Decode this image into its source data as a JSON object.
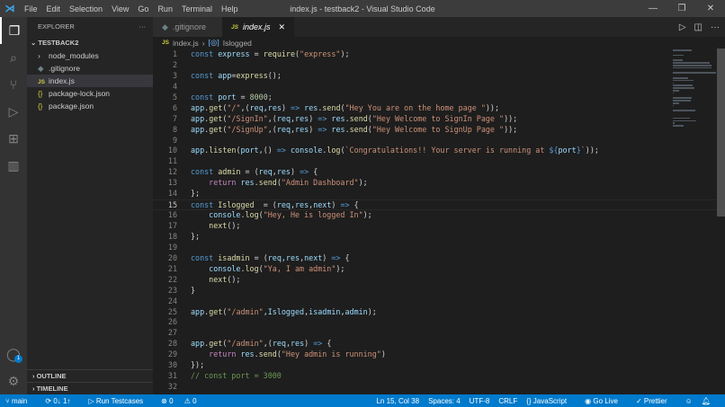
{
  "title_bar": {
    "menus": [
      "File",
      "Edit",
      "Selection",
      "View",
      "Go",
      "Run",
      "Terminal",
      "Help"
    ],
    "window_title": "index.js - testback2 - Visual Studio Code"
  },
  "sidebar": {
    "header": "EXPLORER",
    "more": "···",
    "folder": "TESTBACK2",
    "items": [
      {
        "icon": "chevron-right",
        "label": "node_modules"
      },
      {
        "icon": "gitignore",
        "label": ".gitignore"
      },
      {
        "icon": "js",
        "label": "index.js",
        "selected": true
      },
      {
        "icon": "json",
        "label": "package-lock.json"
      },
      {
        "icon": "json",
        "label": "package.json"
      }
    ],
    "outline": "OUTLINE",
    "timeline": "TIMELINE"
  },
  "tabs": [
    {
      "label": ".gitignore",
      "active": false
    },
    {
      "label": "index.js",
      "active": true
    }
  ],
  "breadcrumb": {
    "file": "index.js",
    "symbol": "Islogged"
  },
  "editor": {
    "current_line": 15,
    "lines": [
      [
        [
          "k",
          "const "
        ],
        [
          "v",
          "express"
        ],
        [
          "p",
          " = "
        ],
        [
          "f",
          "require"
        ],
        [
          "p",
          "("
        ],
        [
          "s",
          "\"express\""
        ],
        [
          "p",
          ");"
        ]
      ],
      [],
      [
        [
          "k",
          "const "
        ],
        [
          "v",
          "app"
        ],
        [
          "p",
          "="
        ],
        [
          "f",
          "express"
        ],
        [
          "p",
          "();"
        ]
      ],
      [],
      [
        [
          "k",
          "const "
        ],
        [
          "v",
          "port"
        ],
        [
          "p",
          " = "
        ],
        [
          "n",
          "8000"
        ],
        [
          "p",
          ";"
        ]
      ],
      [
        [
          "v",
          "app"
        ],
        [
          "p",
          "."
        ],
        [
          "f",
          "get"
        ],
        [
          "p",
          "("
        ],
        [
          "s",
          "\"/\""
        ],
        [
          "p",
          ",("
        ],
        [
          "v",
          "req"
        ],
        [
          "p",
          ","
        ],
        [
          "v",
          "res"
        ],
        [
          "p",
          ") "
        ],
        [
          "k",
          "=>"
        ],
        [
          "p",
          " "
        ],
        [
          "v",
          "res"
        ],
        [
          "p",
          "."
        ],
        [
          "f",
          "send"
        ],
        [
          "p",
          "("
        ],
        [
          "s",
          "\"Hey You are on the home page \""
        ],
        [
          "p",
          "));"
        ]
      ],
      [
        [
          "v",
          "app"
        ],
        [
          "p",
          "."
        ],
        [
          "f",
          "get"
        ],
        [
          "p",
          "("
        ],
        [
          "s",
          "\"/SignIn\""
        ],
        [
          "p",
          ",("
        ],
        [
          "v",
          "req"
        ],
        [
          "p",
          ","
        ],
        [
          "v",
          "res"
        ],
        [
          "p",
          ") "
        ],
        [
          "k",
          "=>"
        ],
        [
          "p",
          " "
        ],
        [
          "v",
          "res"
        ],
        [
          "p",
          "."
        ],
        [
          "f",
          "send"
        ],
        [
          "p",
          "("
        ],
        [
          "s",
          "\"Hey Welcome to SignIn Page \""
        ],
        [
          "p",
          "));"
        ]
      ],
      [
        [
          "v",
          "app"
        ],
        [
          "p",
          "."
        ],
        [
          "f",
          "get"
        ],
        [
          "p",
          "("
        ],
        [
          "s",
          "\"/SignUp\""
        ],
        [
          "p",
          ",("
        ],
        [
          "v",
          "req"
        ],
        [
          "p",
          ","
        ],
        [
          "v",
          "res"
        ],
        [
          "p",
          ") "
        ],
        [
          "k",
          "=>"
        ],
        [
          "p",
          " "
        ],
        [
          "v",
          "res"
        ],
        [
          "p",
          "."
        ],
        [
          "f",
          "send"
        ],
        [
          "p",
          "("
        ],
        [
          "s",
          "\"Hey Welcome to SignUp Page \""
        ],
        [
          "p",
          "));"
        ]
      ],
      [],
      [
        [
          "v",
          "app"
        ],
        [
          "p",
          "."
        ],
        [
          "f",
          "listen"
        ],
        [
          "p",
          "("
        ],
        [
          "v",
          "port"
        ],
        [
          "p",
          ",() "
        ],
        [
          "k",
          "=>"
        ],
        [
          "p",
          " "
        ],
        [
          "v",
          "console"
        ],
        [
          "p",
          "."
        ],
        [
          "f",
          "log"
        ],
        [
          "p",
          "("
        ],
        [
          "s",
          "`Congratulations!! Your server is running at "
        ],
        [
          "k",
          "${"
        ],
        [
          "v",
          "port"
        ],
        [
          "k",
          "}"
        ],
        [
          "s",
          "`"
        ],
        [
          "p",
          "));"
        ]
      ],
      [],
      [
        [
          "k",
          "const "
        ],
        [
          "f",
          "admin"
        ],
        [
          "p",
          " = ("
        ],
        [
          "v",
          "req"
        ],
        [
          "p",
          ","
        ],
        [
          "v",
          "res"
        ],
        [
          "p",
          ") "
        ],
        [
          "k",
          "=>"
        ],
        [
          "p",
          " {"
        ]
      ],
      [
        [
          "p",
          "    "
        ],
        [
          "r",
          "return "
        ],
        [
          "v",
          "res"
        ],
        [
          "p",
          "."
        ],
        [
          "f",
          "send"
        ],
        [
          "p",
          "("
        ],
        [
          "s",
          "\"Admin Dashboard\""
        ],
        [
          "p",
          ");"
        ]
      ],
      [
        [
          "p",
          "};"
        ]
      ],
      [
        [
          "k",
          "const "
        ],
        [
          "f",
          "Islogged"
        ],
        [
          "p",
          "  = ("
        ],
        [
          "v",
          "req"
        ],
        [
          "p",
          ","
        ],
        [
          "v",
          "res"
        ],
        [
          "p",
          ","
        ],
        [
          "v",
          "next"
        ],
        [
          "p",
          ") "
        ],
        [
          "k",
          "=>"
        ],
        [
          "p",
          " {"
        ]
      ],
      [
        [
          "p",
          "    "
        ],
        [
          "v",
          "console"
        ],
        [
          "p",
          "."
        ],
        [
          "f",
          "log"
        ],
        [
          "p",
          "("
        ],
        [
          "s",
          "\"Hey, He is logged In\""
        ],
        [
          "p",
          ");"
        ]
      ],
      [
        [
          "p",
          "    "
        ],
        [
          "f",
          "next"
        ],
        [
          "p",
          "();"
        ]
      ],
      [
        [
          "p",
          "};"
        ]
      ],
      [],
      [
        [
          "k",
          "const "
        ],
        [
          "f",
          "isadmin"
        ],
        [
          "p",
          " = ("
        ],
        [
          "v",
          "req"
        ],
        [
          "p",
          ","
        ],
        [
          "v",
          "res"
        ],
        [
          "p",
          ","
        ],
        [
          "v",
          "next"
        ],
        [
          "p",
          ") "
        ],
        [
          "k",
          "=>"
        ],
        [
          "p",
          " {"
        ]
      ],
      [
        [
          "p",
          "    "
        ],
        [
          "v",
          "console"
        ],
        [
          "p",
          "."
        ],
        [
          "f",
          "log"
        ],
        [
          "p",
          "("
        ],
        [
          "s",
          "\"Ya, I am admin\""
        ],
        [
          "p",
          ");"
        ]
      ],
      [
        [
          "p",
          "    "
        ],
        [
          "f",
          "next"
        ],
        [
          "p",
          "();"
        ]
      ],
      [
        [
          "p",
          "}"
        ]
      ],
      [],
      [
        [
          "v",
          "app"
        ],
        [
          "p",
          "."
        ],
        [
          "f",
          "get"
        ],
        [
          "p",
          "("
        ],
        [
          "s",
          "\"/admin\""
        ],
        [
          "p",
          ","
        ],
        [
          "v",
          "Islogged"
        ],
        [
          "p",
          ","
        ],
        [
          "v",
          "isadmin"
        ],
        [
          "p",
          ","
        ],
        [
          "v",
          "admin"
        ],
        [
          "p",
          ");"
        ]
      ],
      [],
      [],
      [
        [
          "v",
          "app"
        ],
        [
          "p",
          "."
        ],
        [
          "f",
          "get"
        ],
        [
          "p",
          "("
        ],
        [
          "s",
          "\"/admin\""
        ],
        [
          "p",
          ",("
        ],
        [
          "v",
          "req"
        ],
        [
          "p",
          ","
        ],
        [
          "v",
          "res"
        ],
        [
          "p",
          ") "
        ],
        [
          "k",
          "=>"
        ],
        [
          "p",
          " {"
        ]
      ],
      [
        [
          "p",
          "    "
        ],
        [
          "r",
          "return "
        ],
        [
          "v",
          "res"
        ],
        [
          "p",
          "."
        ],
        [
          "f",
          "send"
        ],
        [
          "p",
          "("
        ],
        [
          "s",
          "\"Hey admin is running\""
        ],
        [
          "p",
          ")"
        ]
      ],
      [
        [
          "p",
          "});"
        ]
      ],
      [
        [
          "c",
          "// const port = 3000"
        ]
      ],
      []
    ]
  },
  "status_bar": {
    "branch": "main",
    "sync": "0↓ 1↑",
    "run": "Run Testcases",
    "errors": "0",
    "warnings": "0",
    "position": "Ln 15, Col 38",
    "spaces": "Spaces: 4",
    "encoding": "UTF-8",
    "eol": "CRLF",
    "language": "JavaScript",
    "golive": "Go Live",
    "prettier": "Prettier"
  },
  "accounts_badge": "1"
}
